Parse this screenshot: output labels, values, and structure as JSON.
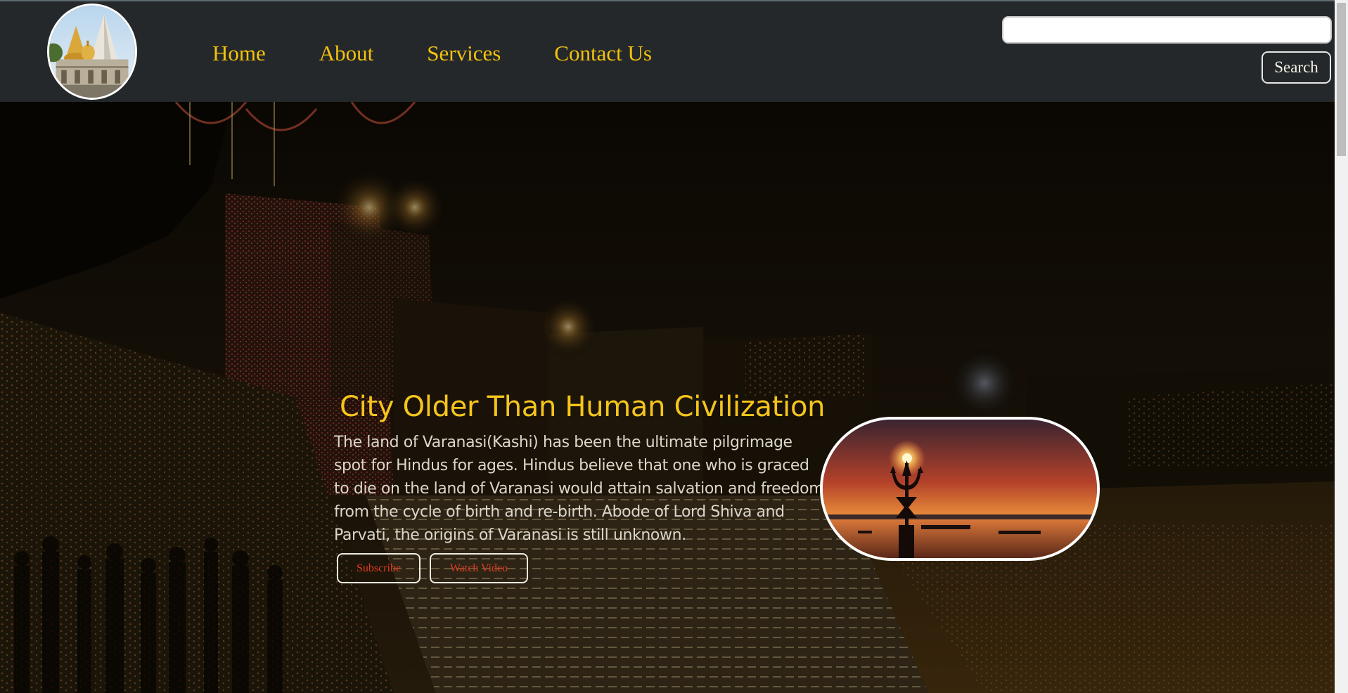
{
  "nav": {
    "logo_alt": "Temple logo",
    "links": [
      {
        "label": "Home"
      },
      {
        "label": "About"
      },
      {
        "label": "Services"
      },
      {
        "label": "Contact Us"
      }
    ],
    "search": {
      "value": "",
      "placeholder": "",
      "button_label": "Search"
    }
  },
  "hero": {
    "title": "City Older Than Human Civilization",
    "description": "The land of Varanasi(Kashi) has been the ultimate pilgrimage spot for Hindus for ages. Hindus believe that one who is graced to die on the land of Varanasi would attain salvation and freedom from the cycle of birth and re-birth. Abode of Lord Shiva and Parvati, the origins of Varanasi is still unknown.",
    "buttons": {
      "subscribe": "Subscribe",
      "watch_video": "Watch Video"
    }
  },
  "colors": {
    "nav_background": "#24282a",
    "accent_gold": "#f4c20d",
    "button_text_red": "#e23c1e"
  }
}
